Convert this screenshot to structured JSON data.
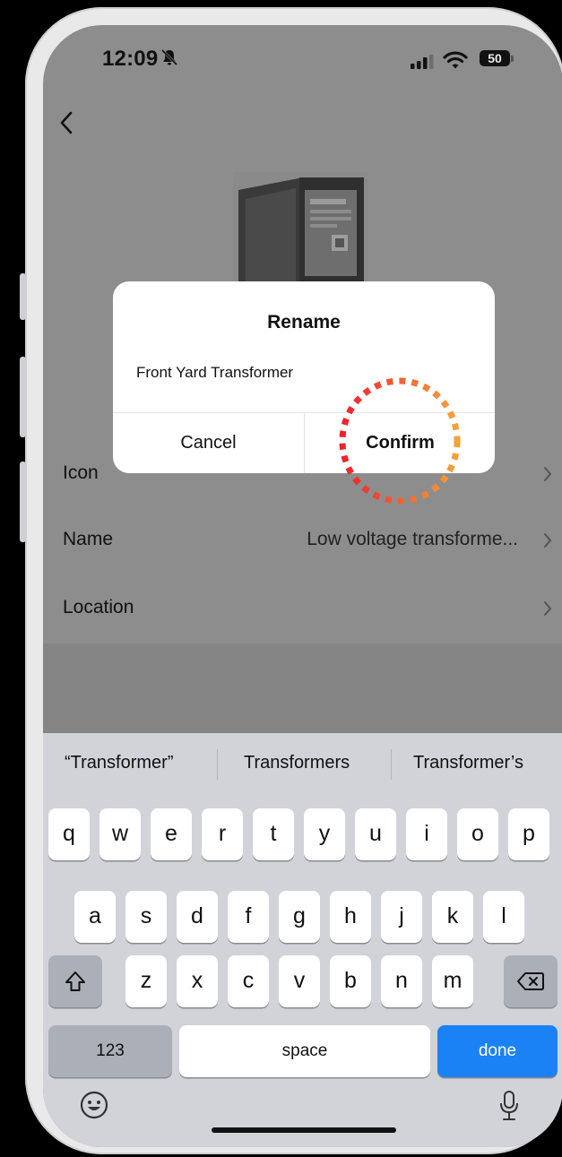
{
  "status_bar": {
    "time": "12:09",
    "battery": "50"
  },
  "dialog": {
    "title": "Rename",
    "input_value": "Front Yard Transformer",
    "cancel_label": "Cancel",
    "confirm_label": "Confirm"
  },
  "settings": {
    "rows": [
      {
        "label": "Icon",
        "value": ""
      },
      {
        "label": "Name",
        "value": "Low voltage transforme..."
      },
      {
        "label": "Location",
        "value": ""
      }
    ]
  },
  "keyboard": {
    "suggestions": [
      "“Transformer”",
      "Transformers",
      "Transformer’s"
    ],
    "row1": [
      "q",
      "w",
      "e",
      "r",
      "t",
      "y",
      "u",
      "i",
      "o",
      "p"
    ],
    "row2": [
      "a",
      "s",
      "d",
      "f",
      "g",
      "h",
      "j",
      "k",
      "l"
    ],
    "row3": [
      "z",
      "x",
      "c",
      "v",
      "b",
      "n",
      "m"
    ],
    "num_label": "123",
    "space_label": "space",
    "done_label": "done"
  },
  "icons": {
    "back": "chevron-left-icon",
    "bell": "bell-slash-icon",
    "signal": "cellular-signal-icon",
    "wifi": "wifi-icon",
    "shift": "shift-icon",
    "delete": "backspace-icon",
    "emoji": "emoji-icon",
    "mic": "microphone-icon"
  },
  "colors": {
    "done_key": "#1a82f5",
    "highlight_ring": "#f04a2c"
  }
}
